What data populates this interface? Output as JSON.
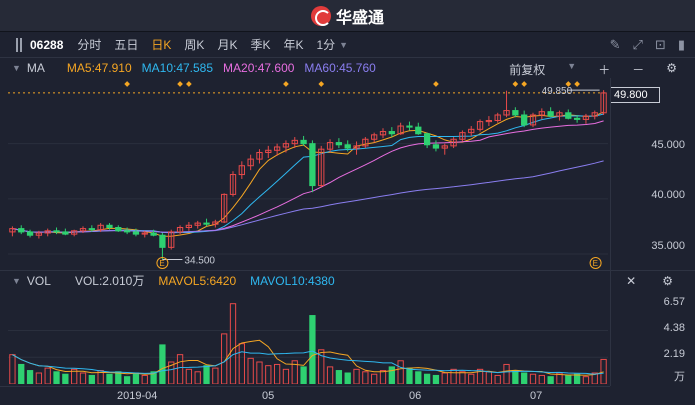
{
  "app": {
    "brand": "华盛通"
  },
  "toolbar": {
    "code": "06288",
    "periods": [
      "分时",
      "五日",
      "日K",
      "周K",
      "月K",
      "季K",
      "年K"
    ],
    "active_period": "日K",
    "minute": "1分"
  },
  "main": {
    "indicator": "MA",
    "ma5": "MA5:47.910",
    "ma10": "MA10:47.585",
    "ma20": "MA20:47.600",
    "ma60": "MA60:45.760",
    "adjust": "前复权",
    "price_axis": [
      "49.800",
      "45.000",
      "40.000",
      "35.000"
    ],
    "high_label": "49.850",
    "low_label": "34.500",
    "event_marker": "E"
  },
  "volume": {
    "indicator": "VOL",
    "vol": "VOL:2.010万",
    "mavol5": "MAVOL5:6420",
    "mavol10": "MAVOL10:4380",
    "axis": [
      "6.57",
      "4.38",
      "2.19",
      "万"
    ]
  },
  "xaxis": [
    "2019-04",
    "05",
    "06",
    "07"
  ],
  "colors": {
    "up": "#e84a4a",
    "down": "#2ed171",
    "ma5": "#f5a623",
    "ma10": "#2fb8f0",
    "ma20": "#e86ee0",
    "ma60": "#8a7ef0"
  },
  "chart_data": {
    "type": "candlestick",
    "candles": [
      [
        37.0,
        37.5,
        36.6,
        37.3
      ],
      [
        37.3,
        37.6,
        36.8,
        37.0
      ],
      [
        37.0,
        37.2,
        36.5,
        36.7
      ],
      [
        36.7,
        37.1,
        36.4,
        36.9
      ],
      [
        36.9,
        37.3,
        36.6,
        37.1
      ],
      [
        37.1,
        37.4,
        36.8,
        37.0
      ],
      [
        37.0,
        37.3,
        36.7,
        36.8
      ],
      [
        36.8,
        37.2,
        36.6,
        37.1
      ],
      [
        37.1,
        37.5,
        36.9,
        37.3
      ],
      [
        37.3,
        37.6,
        37.0,
        37.2
      ],
      [
        37.2,
        37.8,
        37.0,
        37.6
      ],
      [
        37.6,
        37.8,
        37.2,
        37.4
      ],
      [
        37.4,
        37.6,
        37.0,
        37.1
      ],
      [
        37.1,
        37.4,
        36.8,
        37.0
      ],
      [
        37.0,
        37.3,
        36.6,
        36.8
      ],
      [
        36.8,
        37.1,
        36.5,
        36.9
      ],
      [
        36.9,
        37.2,
        36.6,
        36.7
      ],
      [
        36.7,
        36.9,
        34.5,
        35.6
      ],
      [
        35.6,
        37.2,
        35.4,
        37.0
      ],
      [
        37.0,
        37.6,
        36.8,
        37.4
      ],
      [
        37.4,
        37.9,
        37.1,
        37.6
      ],
      [
        37.6,
        38.0,
        37.3,
        37.8
      ],
      [
        37.8,
        38.2,
        37.5,
        37.7
      ],
      [
        37.7,
        38.1,
        37.4,
        37.9
      ],
      [
        37.9,
        40.5,
        37.8,
        40.4
      ],
      [
        40.4,
        42.5,
        40.2,
        42.2
      ],
      [
        42.2,
        43.4,
        41.8,
        43.0
      ],
      [
        43.0,
        44.0,
        42.6,
        43.6
      ],
      [
        43.6,
        44.5,
        43.2,
        44.2
      ],
      [
        44.2,
        44.8,
        43.7,
        44.4
      ],
      [
        44.4,
        45.0,
        43.9,
        44.7
      ],
      [
        44.7,
        45.3,
        44.2,
        45.0
      ],
      [
        45.0,
        45.6,
        44.6,
        45.3
      ],
      [
        45.3,
        45.7,
        44.8,
        45.0
      ],
      [
        45.0,
        45.3,
        40.6,
        41.2
      ],
      [
        41.2,
        44.8,
        41.0,
        44.5
      ],
      [
        44.5,
        45.4,
        44.2,
        45.1
      ],
      [
        45.1,
        45.5,
        44.6,
        44.9
      ],
      [
        44.9,
        45.3,
        44.3,
        44.6
      ],
      [
        44.6,
        45.2,
        44.0,
        44.8
      ],
      [
        44.8,
        45.6,
        44.6,
        45.4
      ],
      [
        45.4,
        46.0,
        45.1,
        45.8
      ],
      [
        45.8,
        46.4,
        45.5,
        46.1
      ],
      [
        46.1,
        46.5,
        45.6,
        45.9
      ],
      [
        45.9,
        46.9,
        45.8,
        46.6
      ],
      [
        46.6,
        47.0,
        46.2,
        46.5
      ],
      [
        46.5,
        46.9,
        45.8,
        45.9
      ],
      [
        45.9,
        46.0,
        44.6,
        44.9
      ],
      [
        44.9,
        45.3,
        44.3,
        44.6
      ],
      [
        44.6,
        45.0,
        44.0,
        44.8
      ],
      [
        44.8,
        45.6,
        44.6,
        45.4
      ],
      [
        45.4,
        46.2,
        45.2,
        46.0
      ],
      [
        46.0,
        46.6,
        45.7,
        46.3
      ],
      [
        46.3,
        47.2,
        46.1,
        47.0
      ],
      [
        47.0,
        47.5,
        46.6,
        47.1
      ],
      [
        47.1,
        47.8,
        46.9,
        47.6
      ],
      [
        47.6,
        49.8,
        47.4,
        48.0
      ],
      [
        48.0,
        48.3,
        47.4,
        47.6
      ],
      [
        47.6,
        48.0,
        46.5,
        46.7
      ],
      [
        46.7,
        47.8,
        46.5,
        47.6
      ],
      [
        47.6,
        48.2,
        47.2,
        47.9
      ],
      [
        47.9,
        48.3,
        47.4,
        47.5
      ],
      [
        47.5,
        48.0,
        47.1,
        47.8
      ],
      [
        47.8,
        48.1,
        47.2,
        47.3
      ],
      [
        47.3,
        47.6,
        46.9,
        47.2
      ],
      [
        47.2,
        47.7,
        46.8,
        47.5
      ],
      [
        47.5,
        48.0,
        47.2,
        47.8
      ],
      [
        47.8,
        49.85,
        47.6,
        49.6
      ]
    ],
    "volume": [
      2.4,
      1.6,
      1.1,
      0.9,
      1.3,
      1.0,
      0.8,
      1.2,
      0.9,
      0.7,
      1.1,
      0.8,
      1.0,
      0.6,
      0.9,
      0.7,
      1.0,
      3.2,
      1.8,
      2.4,
      1.2,
      1.0,
      1.5,
      1.3,
      4.1,
      6.57,
      3.3,
      2.1,
      1.8,
      1.5,
      1.6,
      1.2,
      1.9,
      1.4,
      5.6,
      2.8,
      1.4,
      1.1,
      0.9,
      1.2,
      1.0,
      0.8,
      1.1,
      1.4,
      1.9,
      1.3,
      1.0,
      0.8,
      0.7,
      0.9,
      1.2,
      1.0,
      0.8,
      1.2,
      1.0,
      0.7,
      1.6,
      1.1,
      0.9,
      0.8,
      0.7,
      0.6,
      0.9,
      0.7,
      0.8,
      0.6,
      0.9,
      2.01
    ],
    "ylim": [
      34.0,
      50.5
    ],
    "vol_ylim": [
      0,
      7.2
    ]
  }
}
